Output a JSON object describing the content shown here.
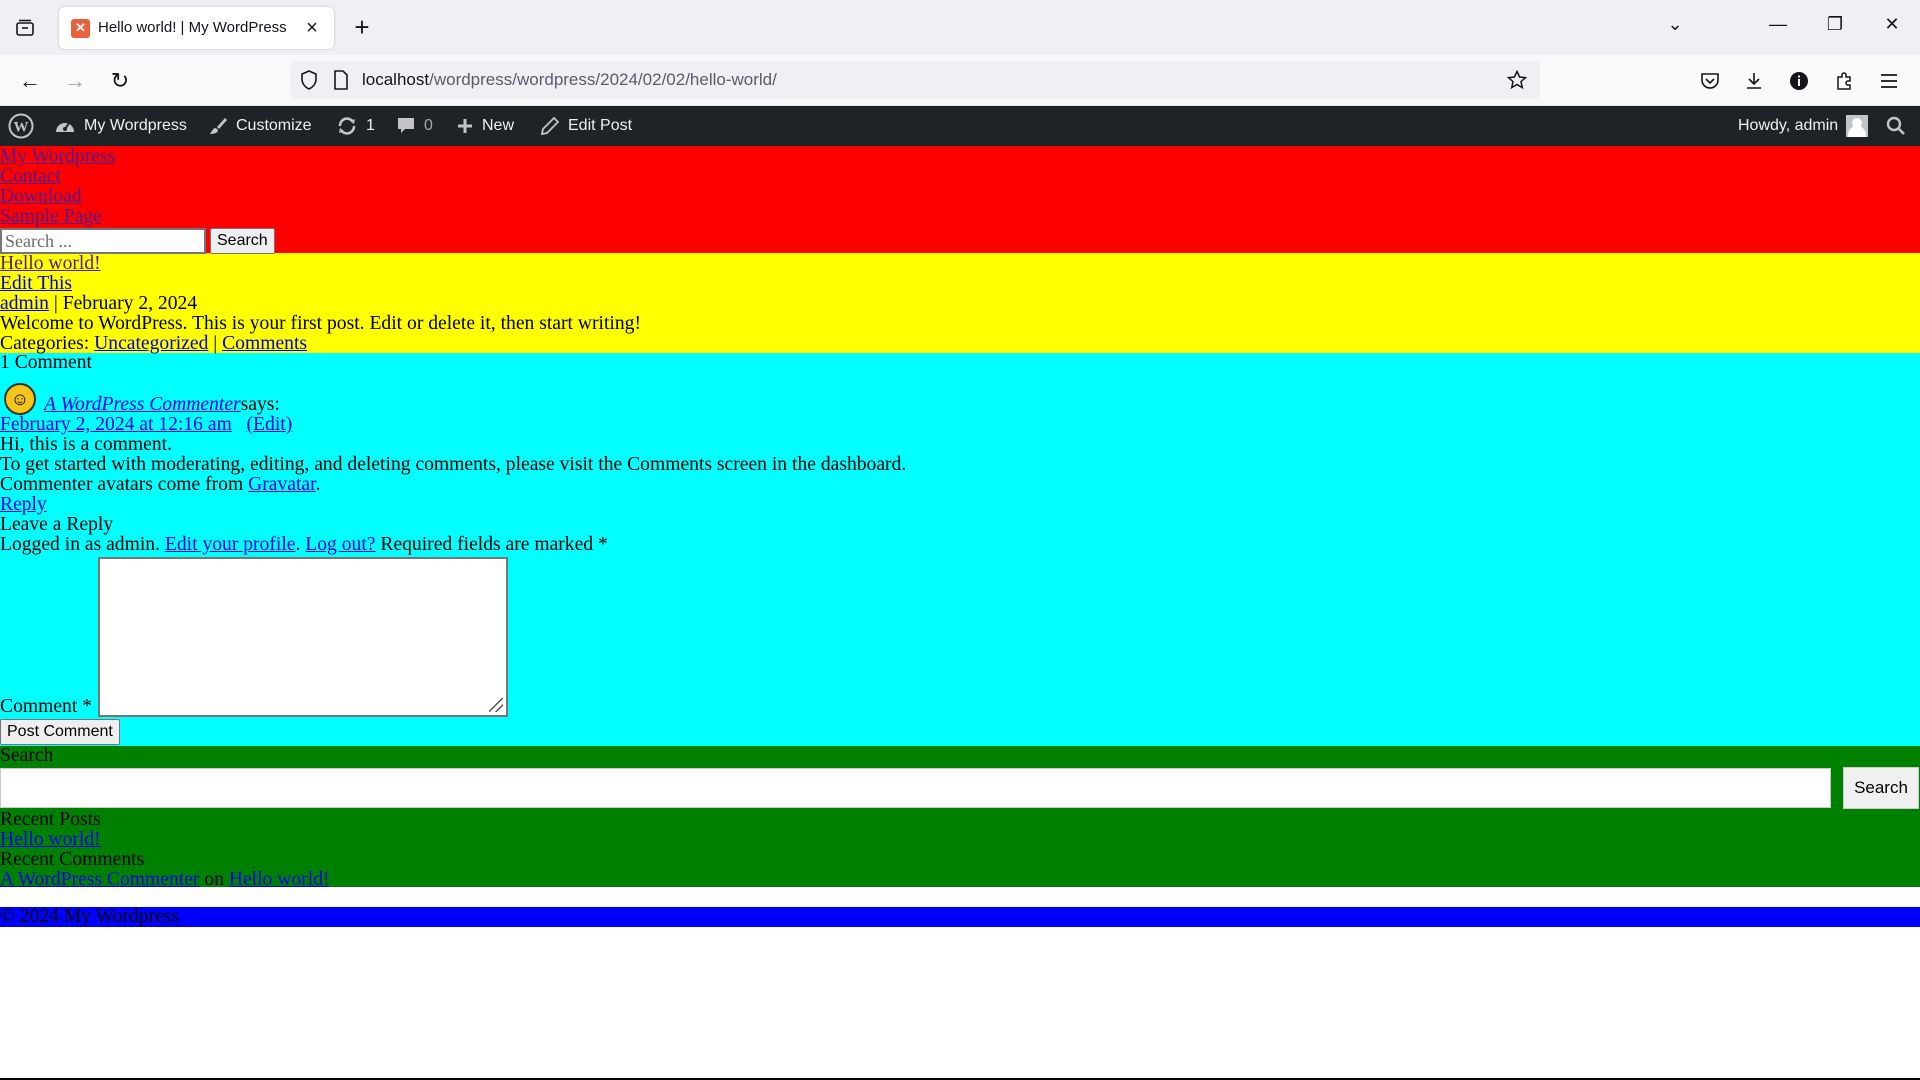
{
  "browser": {
    "tab_title": "Hello world! | My WordPress",
    "new_tab_symbol": "+",
    "url_host": "localhost",
    "url_path": "/wordpress/wordpress/2024/02/02/hello-world/"
  },
  "adminbar": {
    "site_name": "My Wordpress",
    "customize": "Customize",
    "updates_count": "1",
    "comments_count": "0",
    "new_label": "New",
    "edit_post": "Edit Post",
    "howdy": "Howdy, admin"
  },
  "header": {
    "nav": [
      "My Wordpress",
      "Contact",
      "Download",
      "Sample Page"
    ],
    "search_placeholder": "Search ...",
    "search_button": "Search"
  },
  "post": {
    "title": "Hello world!",
    "edit_link": "Edit This",
    "author": "admin",
    "date_sep": " | February 2, 2024",
    "content": "Welcome to WordPress. This is your first post. Edit or delete it, then start writing!",
    "categories_label": "Categories: ",
    "category": "Uncategorized",
    "sep": " | ",
    "comments_link": "Comments"
  },
  "comments": {
    "count_title": "1 Comment",
    "author": "A WordPress Commenter",
    "says": " says:",
    "date": "February 2, 2024 at 12:16 am",
    "edit": "(Edit)",
    "line1": "Hi, this is a comment.",
    "line2": "To get started with moderating, editing, and deleting comments, please visit the Comments screen in the dashboard.",
    "line3_prefix": "Commenter avatars come from ",
    "gravatar": "Gravatar",
    "line3_suffix": ".",
    "reply": "Reply",
    "leave_reply": "Leave a Reply",
    "logged_in_prefix": "Logged in as admin. ",
    "edit_profile": "Edit your profile",
    "dot_space": ". ",
    "log_out": "Log out?",
    "required": " Required fields are marked *",
    "comment_label": "Comment *",
    "post_comment": "Post Comment"
  },
  "sidebar": {
    "search_label": "Search",
    "search_button": "Search",
    "recent_posts_title": "Recent Posts",
    "recent_post": "Hello world!",
    "recent_comments_title": "Recent Comments",
    "recent_comment_author": "A WordPress Commenter",
    "on": " on ",
    "recent_comment_post": "Hello world!"
  },
  "footer": {
    "copyright": "© 2024 My Wordpress"
  }
}
